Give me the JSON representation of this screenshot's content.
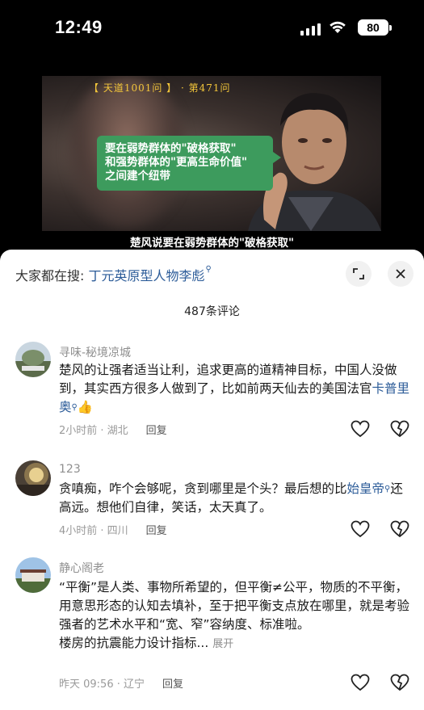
{
  "status_bar": {
    "time": "12:49",
    "battery": "80"
  },
  "video": {
    "series_label": "【 天道1001问 】 · 第471问",
    "bubble_lines": [
      "要在弱势群体的\"破格获取\"",
      "和强势群体的\"更高生命价值\"",
      "之间建个纽带"
    ],
    "subtitle": "楚风说要在弱势群体的\"破格获取\""
  },
  "sheet": {
    "search_prefix": "大家都在搜: ",
    "search_keyword": "丁元英原型人物李彪",
    "comment_count": "487条评论",
    "icons": {
      "expand": "expand-icon",
      "close": "close-icon",
      "search": "search-icon",
      "like": "heart-icon",
      "dislike": "broken-heart-icon"
    }
  },
  "comments": [
    {
      "name": "寻味-秘境凉城",
      "text": "楚风的让强者适当让利，追求更高的道精神目标，中国人没做到，其实西方很多人做到了，比如前两天仙去的美国法官",
      "link": "卡普里奥",
      "emoji": "👍",
      "time_loc": "2小时前 · 湖北",
      "reply": "回复"
    },
    {
      "name": "123",
      "text": "贪嗔痴，咋个会够呢，贪到哪里是个头？最后想的比",
      "link": "始皇帝",
      "text_after": "还高远。想他们自律，笑话，太天真了。",
      "time_loc": "4小时前 · 四川",
      "reply": "回复"
    },
    {
      "name": "静心阁老",
      "text": "“平衡”是人类、事物所希望的，但平衡≠公平，物质的不平衡，用意思形态的认知去填补，至于把平衡支点放在哪里，就是考验强者的艺术水平和“宽、窄”容纳度、标准啦。",
      "text2": "楼房的抗震能力设计指标...",
      "more": "展开",
      "time_loc": "昨天 09:56 · 辽宁",
      "reply": "回复"
    }
  ]
}
